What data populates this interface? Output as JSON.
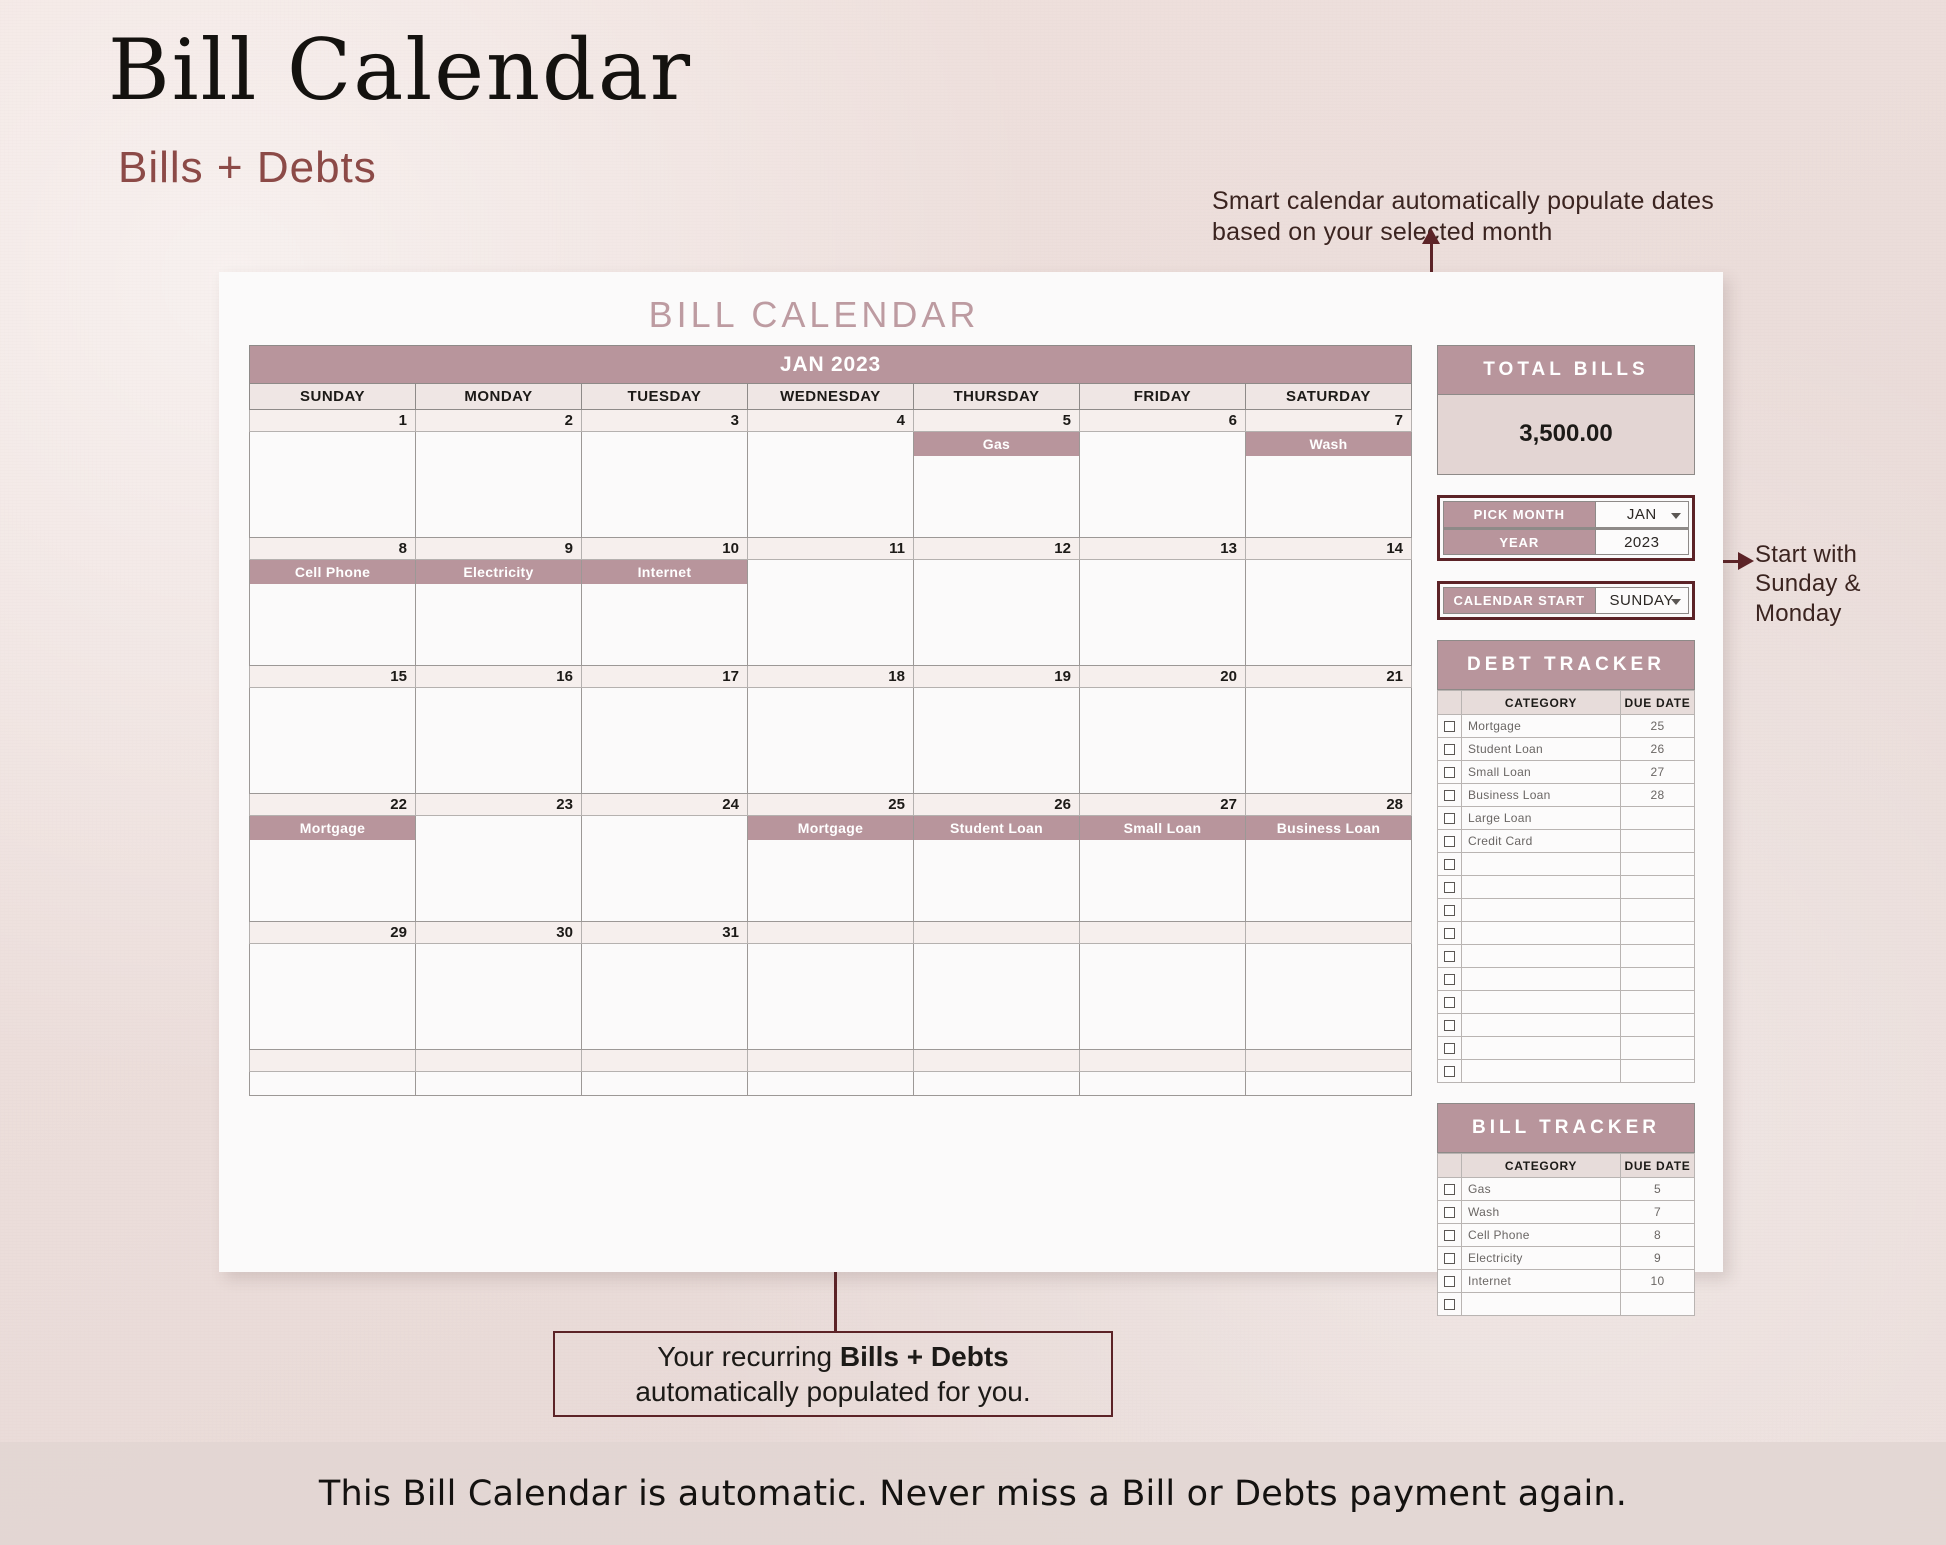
{
  "header": {
    "title": "Bill Calendar",
    "subtitle": "Bills + Debts"
  },
  "annotations": {
    "top": "Smart calendar automatically populate dates\nbased on your selected month",
    "right": "Start with\nSunday & Monday",
    "bottom_line1_prefix": "Your recurring ",
    "bottom_line1_bold": "Bills + Debts",
    "bottom_line2": "automatically populated for you."
  },
  "sheet": {
    "title": "BILL CALENDAR"
  },
  "calendar": {
    "month_label": "JAN 2023",
    "weekdays": [
      "SUNDAY",
      "MONDAY",
      "TUESDAY",
      "WEDNESDAY",
      "THURSDAY",
      "FRIDAY",
      "SATURDAY"
    ],
    "weeks": [
      {
        "days": [
          {
            "num": "1",
            "event": ""
          },
          {
            "num": "2",
            "event": ""
          },
          {
            "num": "3",
            "event": ""
          },
          {
            "num": "4",
            "event": ""
          },
          {
            "num": "5",
            "event": "Gas"
          },
          {
            "num": "6",
            "event": ""
          },
          {
            "num": "7",
            "event": "Wash"
          }
        ]
      },
      {
        "days": [
          {
            "num": "8",
            "event": "Cell Phone"
          },
          {
            "num": "9",
            "event": "Electricity"
          },
          {
            "num": "10",
            "event": "Internet"
          },
          {
            "num": "11",
            "event": ""
          },
          {
            "num": "12",
            "event": ""
          },
          {
            "num": "13",
            "event": ""
          },
          {
            "num": "14",
            "event": ""
          }
        ]
      },
      {
        "days": [
          {
            "num": "15",
            "event": ""
          },
          {
            "num": "16",
            "event": ""
          },
          {
            "num": "17",
            "event": ""
          },
          {
            "num": "18",
            "event": ""
          },
          {
            "num": "19",
            "event": ""
          },
          {
            "num": "20",
            "event": ""
          },
          {
            "num": "21",
            "event": ""
          }
        ]
      },
      {
        "days": [
          {
            "num": "22",
            "event": "Mortgage"
          },
          {
            "num": "23",
            "event": ""
          },
          {
            "num": "24",
            "event": ""
          },
          {
            "num": "25",
            "event": "Mortgage"
          },
          {
            "num": "26",
            "event": "Student Loan"
          },
          {
            "num": "27",
            "event": "Small Loan"
          },
          {
            "num": "28",
            "event": "Business Loan"
          }
        ]
      },
      {
        "days": [
          {
            "num": "29",
            "event": ""
          },
          {
            "num": "30",
            "event": ""
          },
          {
            "num": "31",
            "event": ""
          },
          {
            "num": "",
            "event": ""
          },
          {
            "num": "",
            "event": ""
          },
          {
            "num": "",
            "event": ""
          },
          {
            "num": "",
            "event": ""
          }
        ]
      },
      {
        "days": [
          {
            "num": "",
            "event": ""
          },
          {
            "num": "",
            "event": ""
          },
          {
            "num": "",
            "event": ""
          },
          {
            "num": "",
            "event": ""
          },
          {
            "num": "",
            "event": ""
          },
          {
            "num": "",
            "event": ""
          },
          {
            "num": "",
            "event": ""
          }
        ]
      }
    ]
  },
  "panel": {
    "total_bills": {
      "title": "TOTAL BILLS",
      "value": "3,500.00"
    },
    "pick_month": {
      "label": "PICK MONTH",
      "value": "JAN"
    },
    "year": {
      "label": "YEAR",
      "value": "2023"
    },
    "calendar_start": {
      "label": "CALENDAR START",
      "value": "SUNDAY"
    },
    "debt_tracker": {
      "title": "DEBT TRACKER",
      "columns": [
        "CATEGORY",
        "DUE DATE"
      ],
      "rows": [
        {
          "category": "Mortgage",
          "due": "25"
        },
        {
          "category": "Student Loan",
          "due": "26"
        },
        {
          "category": "Small Loan",
          "due": "27"
        },
        {
          "category": "Business Loan",
          "due": "28"
        },
        {
          "category": "Large Loan",
          "due": ""
        },
        {
          "category": "Credit Card",
          "due": ""
        },
        {
          "category": "",
          "due": ""
        },
        {
          "category": "",
          "due": ""
        },
        {
          "category": "",
          "due": ""
        },
        {
          "category": "",
          "due": ""
        },
        {
          "category": "",
          "due": ""
        },
        {
          "category": "",
          "due": ""
        },
        {
          "category": "",
          "due": ""
        },
        {
          "category": "",
          "due": ""
        },
        {
          "category": "",
          "due": ""
        },
        {
          "category": "",
          "due": ""
        }
      ]
    },
    "bill_tracker": {
      "title": "BILL TRACKER",
      "columns": [
        "CATEGORY",
        "DUE DATE"
      ],
      "rows": [
        {
          "category": "Gas",
          "due": "5"
        },
        {
          "category": "Wash",
          "due": "7"
        },
        {
          "category": "Cell Phone",
          "due": "8"
        },
        {
          "category": "Electricity",
          "due": "9"
        },
        {
          "category": "Internet",
          "due": "10"
        },
        {
          "category": "",
          "due": ""
        }
      ]
    }
  },
  "footer": {
    "text": "This Bill Calendar is automatic. Never miss a Bill or Debts payment again."
  }
}
